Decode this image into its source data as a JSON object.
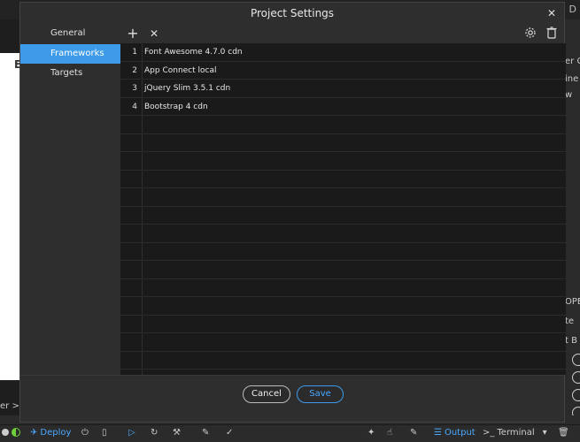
{
  "dialog": {
    "title": "Project Settings",
    "close_glyph": "✕"
  },
  "sidebar": {
    "items": [
      {
        "label": "General",
        "active": false
      },
      {
        "label": "Frameworks",
        "active": true
      },
      {
        "label": "Targets",
        "active": false
      }
    ]
  },
  "toolbar": {
    "add_glyph": "+",
    "remove_glyph": "✕",
    "settings_icon": "gear-icon",
    "delete_icon": "trash-icon"
  },
  "frameworks": [
    {
      "num": "1",
      "name": "Font Awesome 4.7.0 cdn"
    },
    {
      "num": "2",
      "name": "App Connect local"
    },
    {
      "num": "3",
      "name": "jQuery Slim 3.5.1 cdn"
    },
    {
      "num": "4",
      "name": "Bootstrap 4 cdn"
    }
  ],
  "footer": {
    "cancel_label": "Cancel",
    "save_label": "Save"
  },
  "background": {
    "top_right": "D",
    "left_text": "E",
    "left_bottom": "er >",
    "right_texts": [
      "er C",
      "ine",
      "w",
      "OPE",
      "te",
      "t B"
    ]
  },
  "statusbar": {
    "deploy_label": "Deploy",
    "output_label": "Output",
    "terminal_label": "Terminal"
  },
  "colors": {
    "accent": "#3d9be9",
    "dialog_bg": "#2e2e2e",
    "grid_bg": "#1a1a1a"
  }
}
